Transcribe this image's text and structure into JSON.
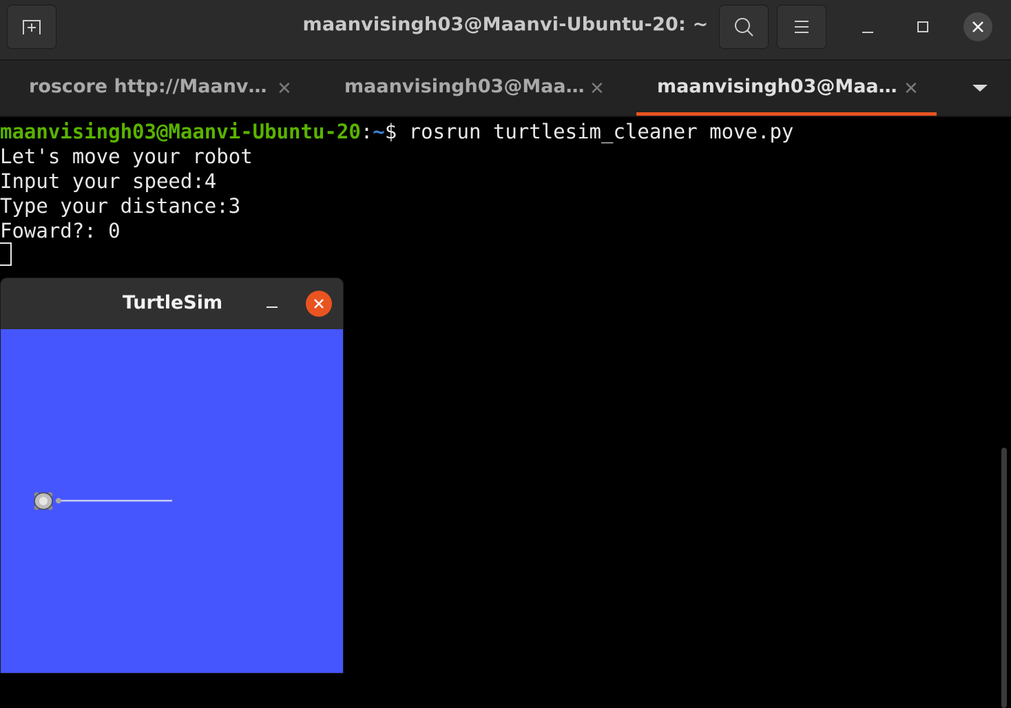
{
  "window": {
    "title": "maanvisingh03@Maanvi-Ubuntu-20: ~",
    "icons": [
      "new-tab-icon",
      "search-icon",
      "hamburger-menu-icon",
      "minimize-icon",
      "maximize-icon",
      "close-icon"
    ]
  },
  "tabs": [
    {
      "label": "roscore http://Maanv…",
      "active": false
    },
    {
      "label": "maanvisingh03@Maa…",
      "active": false
    },
    {
      "label": "maanvisingh03@Maa…",
      "active": true
    }
  ],
  "terminal": {
    "prompt_user": "maanvisingh03@Maanvi-Ubuntu-20",
    "prompt_sep": ":",
    "prompt_path": "~",
    "prompt_symbol": "$ ",
    "command": "rosrun turtlesim_cleaner move.py",
    "output": [
      "Let's move your robot",
      "Input your speed:4",
      "Type your distance:3",
      "Foward?: 0"
    ]
  },
  "turtlesim": {
    "title": "TurtleSim",
    "background": "#4556ff"
  },
  "colors": {
    "accent": "#e95420",
    "prompt_user": "#59b300",
    "prompt_path": "#3b80d8"
  }
}
